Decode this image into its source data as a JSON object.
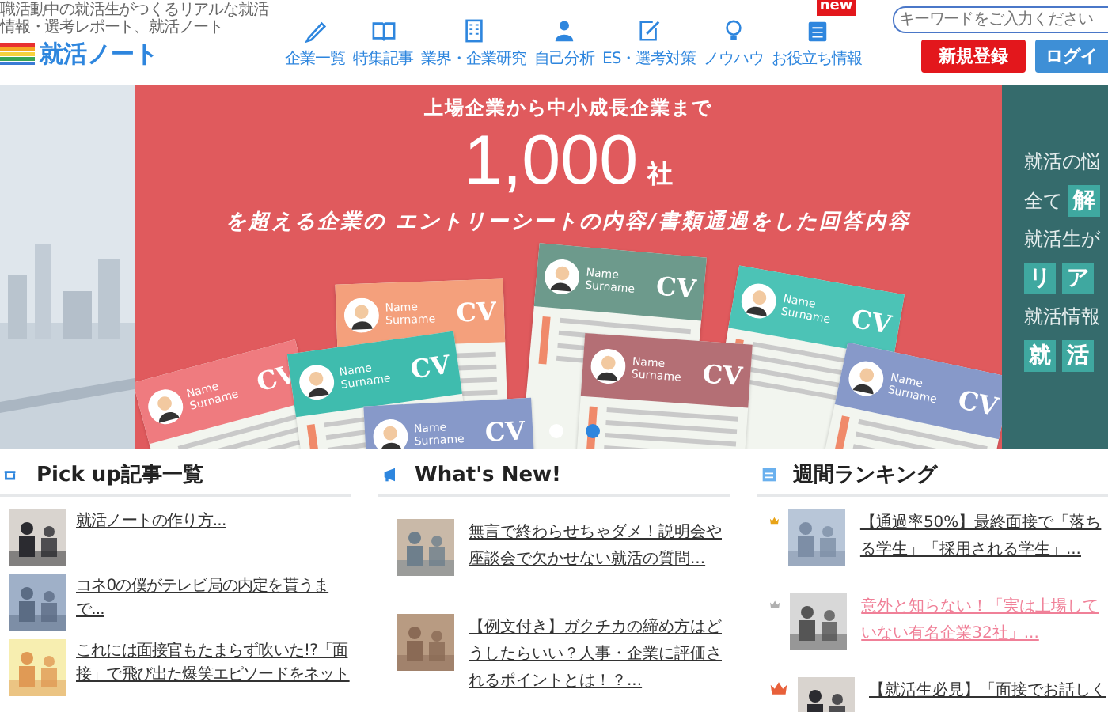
{
  "header": {
    "tagline": "職活動中の就活生がつくるリアルな就活情報・選考レポート、就活ノート",
    "logo": "就活ノート",
    "nav": [
      {
        "label": "企業一覧"
      },
      {
        "label": "特集記事"
      },
      {
        "label": "業界・企業研究"
      },
      {
        "label": "自己分析"
      },
      {
        "label": "ES・選考対策"
      },
      {
        "label": "ノウハウ"
      },
      {
        "label": "お役立ち情報",
        "badge": "new"
      }
    ],
    "search": {
      "placeholder": "キーワードをご入力ください"
    },
    "register_button": "新規登録",
    "login_button": "ログイ"
  },
  "hero": {
    "line1": "**上場企業**から**中小成長企業**まで",
    "count": "1,000",
    "unit": "社",
    "line3": "を超える企業の エントリーシートの内容/書類通過をした回答内容",
    "cv_cards": [
      {
        "color": "#f4a07c",
        "badge": "CV",
        "name": "Name",
        "surname": "Surname"
      },
      {
        "color": "#6d9a8c",
        "badge": "CV",
        "name": "Name",
        "surname": "Surname"
      },
      {
        "color": "#4cc3b6",
        "badge": "CV",
        "name": "Name",
        "surname": "Surname"
      },
      {
        "color": "#ef7b7f",
        "badge": "CV",
        "name": "Name",
        "surname": "Surname"
      },
      {
        "color": "#3fbcae",
        "badge": "CV",
        "name": "Name",
        "surname": "Surname"
      },
      {
        "color": "#b46f75",
        "badge": "CV",
        "name": "Name",
        "surname": "Surname"
      },
      {
        "color": "#8799c9",
        "badge": "CV",
        "name": "Name",
        "surname": "Surname"
      },
      {
        "color": "#8799c9",
        "badge": "CV",
        "name": "Name",
        "surname": "Surname"
      }
    ],
    "dots": [
      {
        "selected": false
      },
      {
        "selected": true
      }
    ]
  },
  "next_slide": {
    "lines": [
      [
        {
          "text": "就活の悩",
          "boxed": false
        }
      ],
      [
        {
          "text": "全て",
          "boxed": false
        },
        {
          "text": "解",
          "boxed": true
        }
      ],
      [
        {
          "text": "就活生が",
          "boxed": false
        }
      ],
      [
        {
          "text": "リ",
          "boxed": true
        },
        {
          "text": "ア",
          "boxed": true
        }
      ],
      [
        {
          "text": "就活情報",
          "boxed": false
        }
      ],
      [
        {
          "text": "就",
          "boxed": true
        },
        {
          "text": "活",
          "boxed": true
        }
      ]
    ]
  },
  "sections": [
    {
      "title": "Pick up記事一覧",
      "kind": "pickup",
      "items": [
        {
          "title": "就活ノートの作り方..."
        },
        {
          "title": "コネ0の僕がテレビ局の内定を貰うまで..."
        },
        {
          "title": "これには面接官もたまらず吹いた!?「面接」で飛び出た爆笑エピソードをネット"
        }
      ]
    },
    {
      "title": "What's New!",
      "kind": "news",
      "items": [
        {
          "title": "無言で終わらせちゃダメ！説明会や座談会で欠かせない就活の質問..."
        },
        {
          "title": "【例文付き】ガクチカの締め方はどうしたらいい？人事・企業に評価されるポイントとは！？..."
        }
      ]
    },
    {
      "title": "週間ランキング",
      "kind": "ranking",
      "items": [
        {
          "title": "【通過率50%】最終面接で「落ちる学生」「採用される学生」...",
          "color": "#e8a317",
          "highlighted": false
        },
        {
          "title": "意外と知らない！「実は上場していない有名企業32社」...",
          "color": "#b0b0b0",
          "highlighted": true
        },
        {
          "title": "【就活生必見】「面接でお話しく",
          "color": "#e8603a",
          "highlighted": false
        }
      ]
    }
  ]
}
